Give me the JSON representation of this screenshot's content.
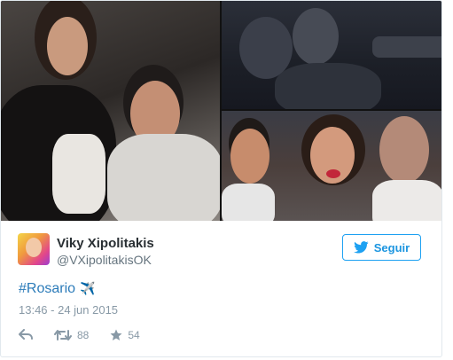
{
  "tweet": {
    "user_name": "Viky Xipolitakis",
    "user_handle": "@VXipolitakisOK",
    "follow_label": "Seguir",
    "hashtag": "#Rosario",
    "emoji": "✈️",
    "timestamp": "13:46 - 24 jun 2015",
    "retweet_count": "88",
    "favorite_count": "54"
  },
  "colors": {
    "brand_blue": "#1da1f2",
    "link_blue": "#2b7bb9",
    "muted_gray": "#8899a6"
  },
  "icons": [
    "twitter-bird-icon",
    "reply-icon",
    "retweet-icon",
    "star-icon",
    "airplane-icon"
  ]
}
